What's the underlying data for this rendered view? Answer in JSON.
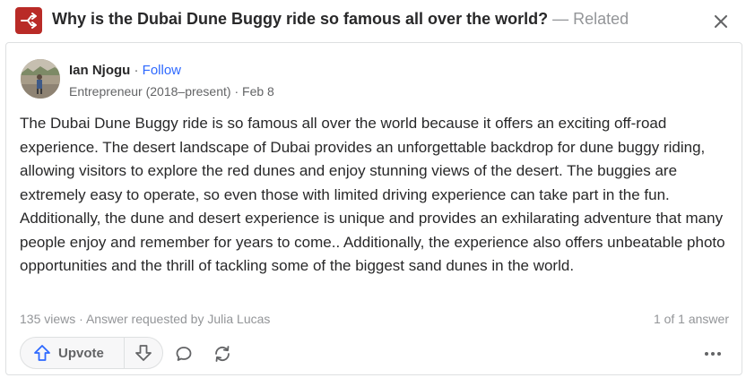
{
  "header": {
    "question": "Why is the Dubai Dune Buggy ride so famous all over the world?",
    "separator": "—",
    "related_label": "Related",
    "icon": "related-question-icon",
    "close_icon": "close-icon"
  },
  "author": {
    "name": "Ian Njogu",
    "dot": "·",
    "follow_label": "Follow",
    "credential": "Entrepreneur (2018–present)",
    "date": "Feb 8"
  },
  "answer": {
    "text": "The Dubai Dune Buggy ride is so famous all over the world because it offers an exciting off-road experience. The desert landscape of Dubai provides an unforgettable backdrop for dune buggy riding, allowing visitors to explore the red dunes and enjoy stunning views of the desert. The buggies are extremely easy to operate, so even those with limited driving experience can take part in the fun. Additionally, the dune and desert experience is unique and provides an exhilarating adventure that many people enjoy and remember for years to come.. Additionally, the experience also offers unbeatable photo opportunities and the thrill of tackling some of the biggest sand dunes in the world."
  },
  "meta": {
    "views": "135 views",
    "dot": "·",
    "requested": "Answer requested by Julia Lucas",
    "answer_count": "1 of 1 answer"
  },
  "actions": {
    "upvote_label": "Upvote"
  },
  "colors": {
    "brand": "#b92b27",
    "link": "#2e69ff",
    "text": "#282829",
    "muted": "#939598"
  }
}
